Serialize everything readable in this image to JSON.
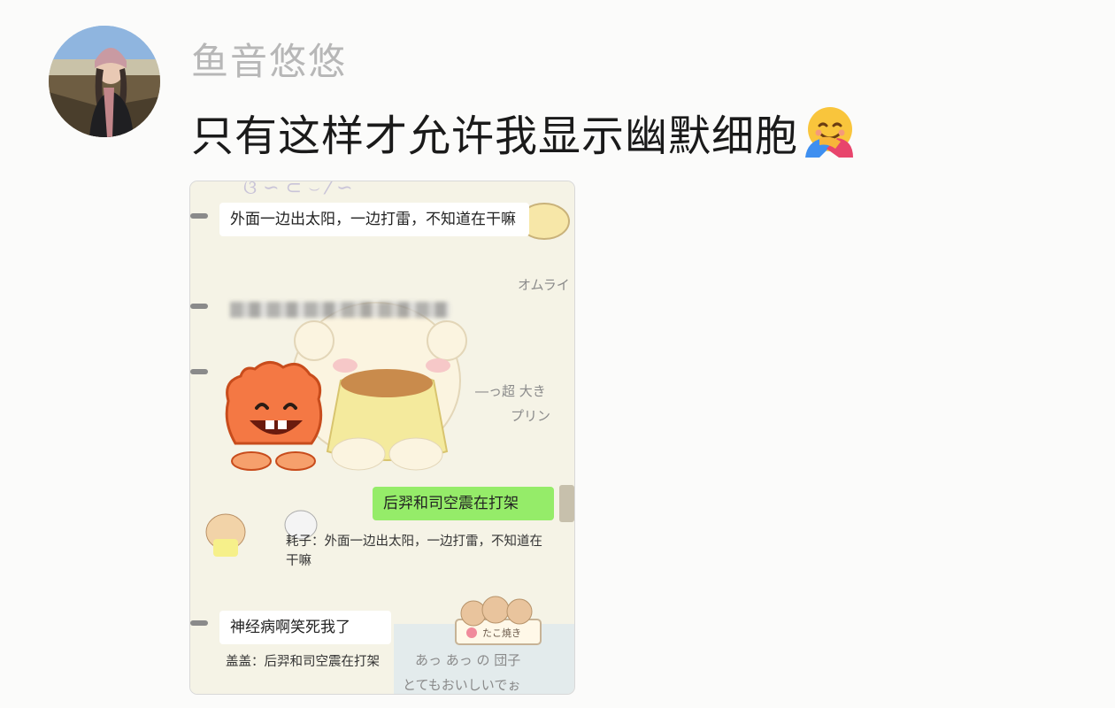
{
  "post": {
    "username": "鱼音悠悠",
    "text": "只有这样才允许我显示幽默细胞",
    "emoji": "hugging-face-icon"
  },
  "chat": {
    "messages": [
      {
        "text": "外面一边出太阳，一边打雷，不知道在干嘛"
      },
      {
        "text": "后羿和司空震在打架",
        "own": true
      },
      {
        "text": "神经病啊笑死我了"
      }
    ],
    "quotes": [
      {
        "text": "耗子：外面一边出太阳，一边打雷，不知道在干嘛"
      },
      {
        "text": "盖盖：后羿和司空震在打架"
      }
    ],
    "background_text": {
      "omurice": "オムライ",
      "pudding": "プリン",
      "big": "―っ超 大き",
      "hot": "あっ あっ の 団子",
      "tasty": "とてもおいしいでぉ",
      "takoyaki": "たこ焼き"
    },
    "accent_bubble": "#95ec69"
  }
}
